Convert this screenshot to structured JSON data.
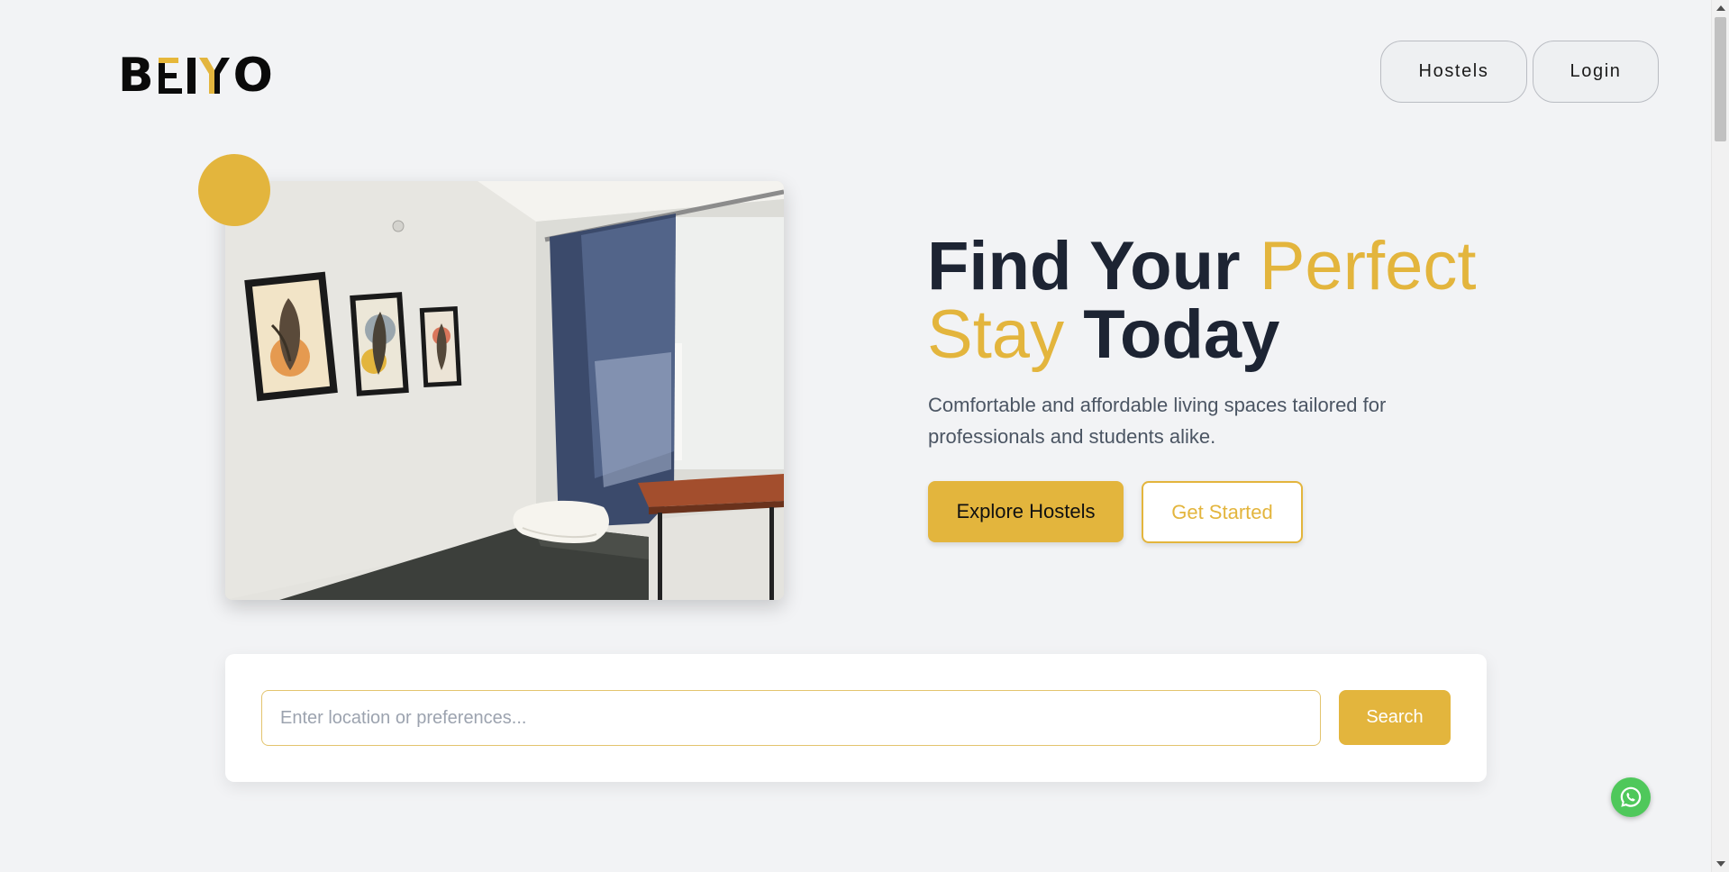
{
  "header": {
    "logo_text": "BEIYO",
    "nav": {
      "hostels_label": "Hostels",
      "login_label": "Login"
    }
  },
  "hero": {
    "title_part1": "Find Your ",
    "title_part2": "Perfect",
    "title_part3": "Stay",
    "title_part4": " Today",
    "subtitle": "Comfortable and affordable living spaces tailored for professionals and students alike.",
    "explore_label": "Explore Hostels",
    "get_started_label": "Get Started",
    "image_alt_icon": "room-photo"
  },
  "search": {
    "placeholder": "Enter location or preferences...",
    "value": "",
    "button_label": "Search"
  },
  "floating": {
    "icon": "whatsapp-icon"
  },
  "colors": {
    "accent": "#e3b53d",
    "heading": "#1d2433",
    "subtext": "#4b5563",
    "background": "#f2f3f5"
  }
}
